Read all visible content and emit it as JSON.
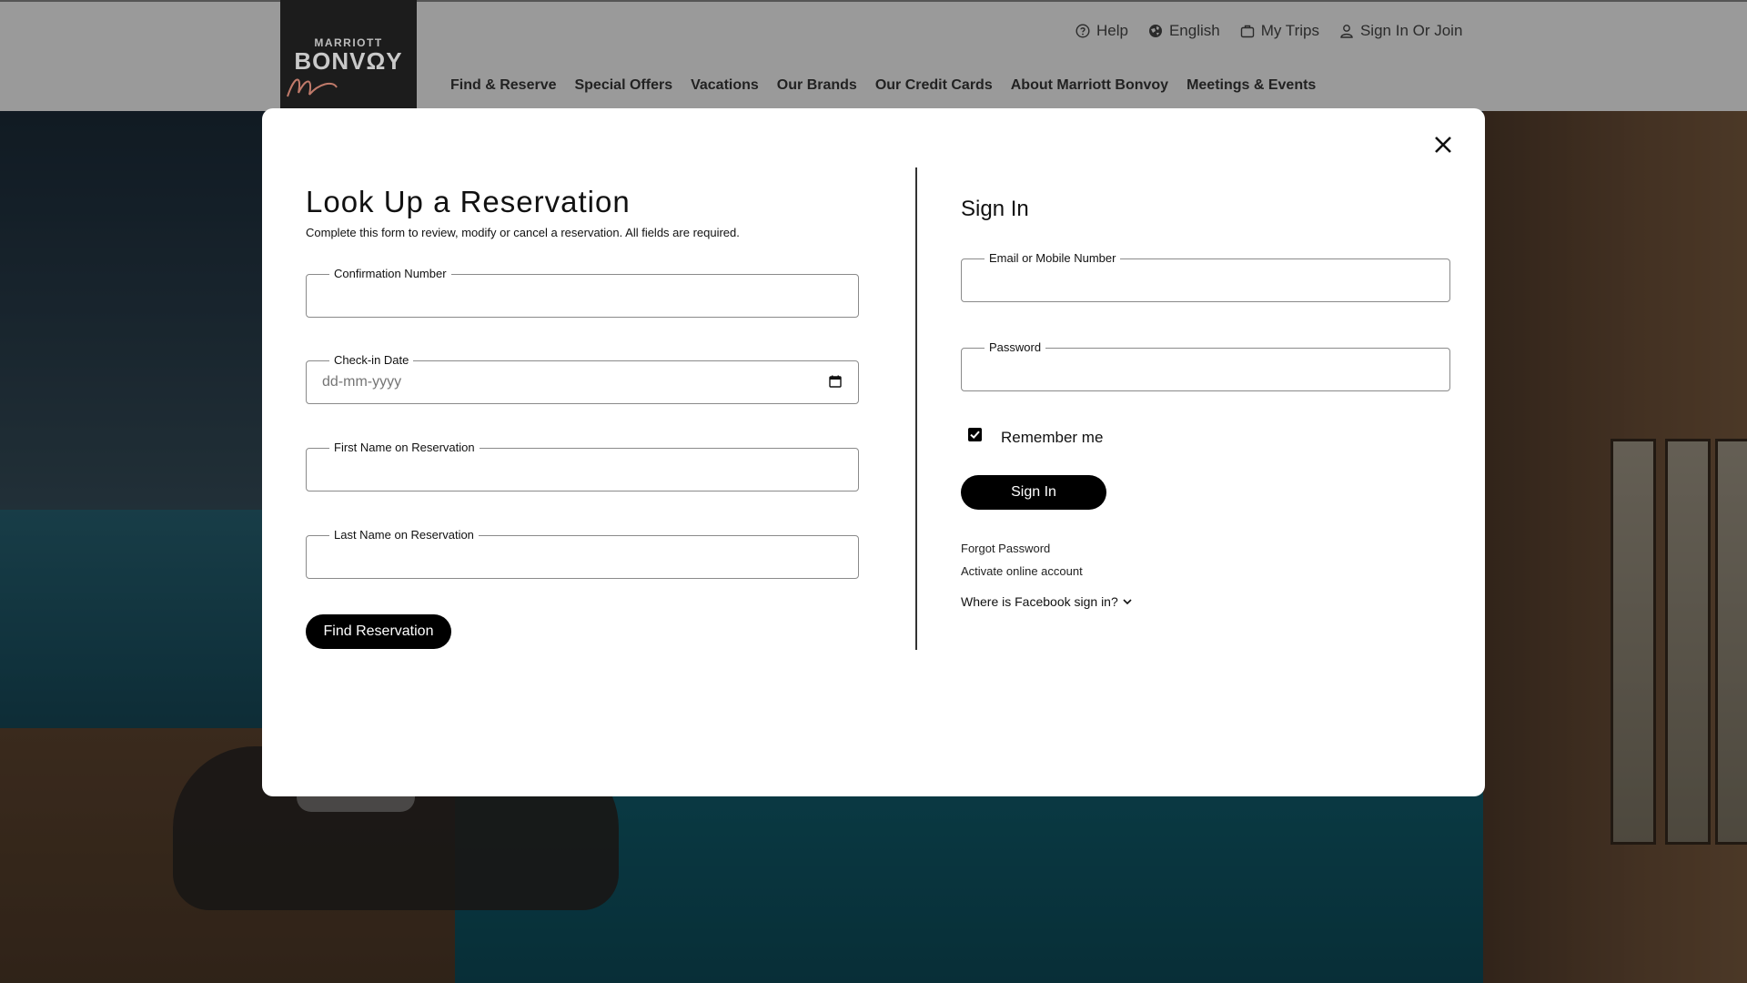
{
  "header": {
    "logo": {
      "small": "MARRIOTT",
      "big": "BONVΩY"
    },
    "utility_nav": [
      {
        "label": "Help",
        "icon": "help-circle-icon"
      },
      {
        "label": "English",
        "icon": "globe-icon"
      },
      {
        "label": "My Trips",
        "icon": "suitcase-icon"
      },
      {
        "label": "Sign In Or Join",
        "icon": "user-icon"
      }
    ],
    "main_nav": [
      "Find & Reserve",
      "Special Offers",
      "Vacations",
      "Our Brands",
      "Our Credit Cards",
      "About Marriott Bonvoy",
      "Meetings & Events"
    ]
  },
  "modal": {
    "close_icon": "close-icon",
    "reservation": {
      "title": "Look Up a Reservation",
      "description": "Complete this form to review, modify or cancel a reservation. All fields are required.",
      "confirmation_label": "Confirmation Number",
      "confirmation_value": "",
      "checkin_label": "Check-in Date",
      "checkin_placeholder": "dd-mm-yyyy",
      "first_name_label": "First Name on Reservation",
      "first_name_value": "",
      "last_name_label": "Last Name on Reservation",
      "last_name_value": "",
      "find_button": "Find Reservation"
    },
    "signin": {
      "title": "Sign In",
      "email_label": "Email or Mobile Number",
      "email_value": "",
      "password_label": "Password",
      "password_value": "",
      "remember_label": "Remember me",
      "remember_checked": true,
      "signin_button": "Sign In",
      "forgot_password": "Forgot Password",
      "activate_account": "Activate online account",
      "facebook_link": "Where is Facebook sign in?"
    }
  },
  "colors": {
    "header_bg": "#9a9a9a",
    "button_bg": "#000000",
    "modal_bg": "#ffffff"
  }
}
